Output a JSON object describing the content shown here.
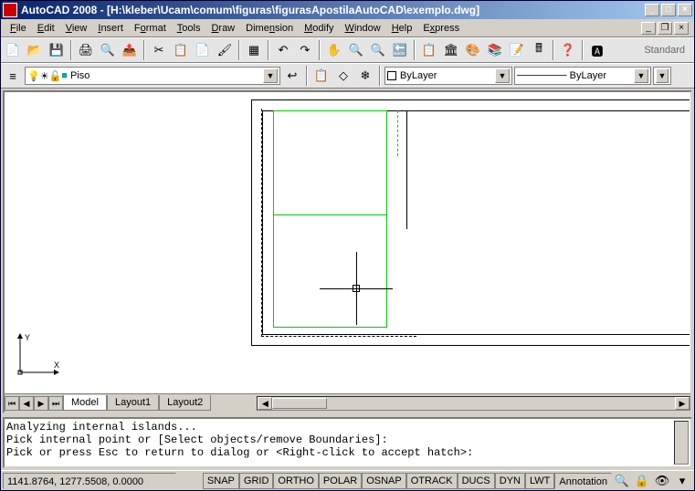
{
  "window": {
    "title": "AutoCAD 2008 - [H:\\kleber\\Ucam\\comum\\figuras\\figurasApostilaAutoCAD\\exemplo.dwg]"
  },
  "menu": {
    "file": "File",
    "edit": "Edit",
    "view": "View",
    "insert": "Insert",
    "format": "Format",
    "tools": "Tools",
    "draw": "Draw",
    "dimension": "Dimension",
    "modify": "Modify",
    "window": "Window",
    "help": "Help",
    "express": "Express"
  },
  "toolbar1": {
    "standard": "Standard"
  },
  "layers": {
    "current": "Piso"
  },
  "props": {
    "bylayer1": "ByLayer",
    "bylayer2": "ByLayer"
  },
  "tabs": {
    "model": "Model",
    "layout1": "Layout1",
    "layout2": "Layout2"
  },
  "cmd": {
    "line1": "Analyzing internal islands...",
    "line2": "Pick internal point or [Select objects/remove Boundaries]:",
    "line3": "Pick or press Esc to return to dialog or <Right-click to accept hatch>:"
  },
  "status": {
    "coords": "1141.8764, 1277.5508, 0.0000",
    "snap": "SNAP",
    "grid": "GRID",
    "ortho": "ORTHO",
    "polar": "POLAR",
    "osnap": "OSNAP",
    "otrack": "OTRACK",
    "ducs": "DUCS",
    "dyn": "DYN",
    "lwt": "LWT",
    "annotation": "Annotation"
  },
  "ucs": {
    "x": "X",
    "y": "Y"
  }
}
